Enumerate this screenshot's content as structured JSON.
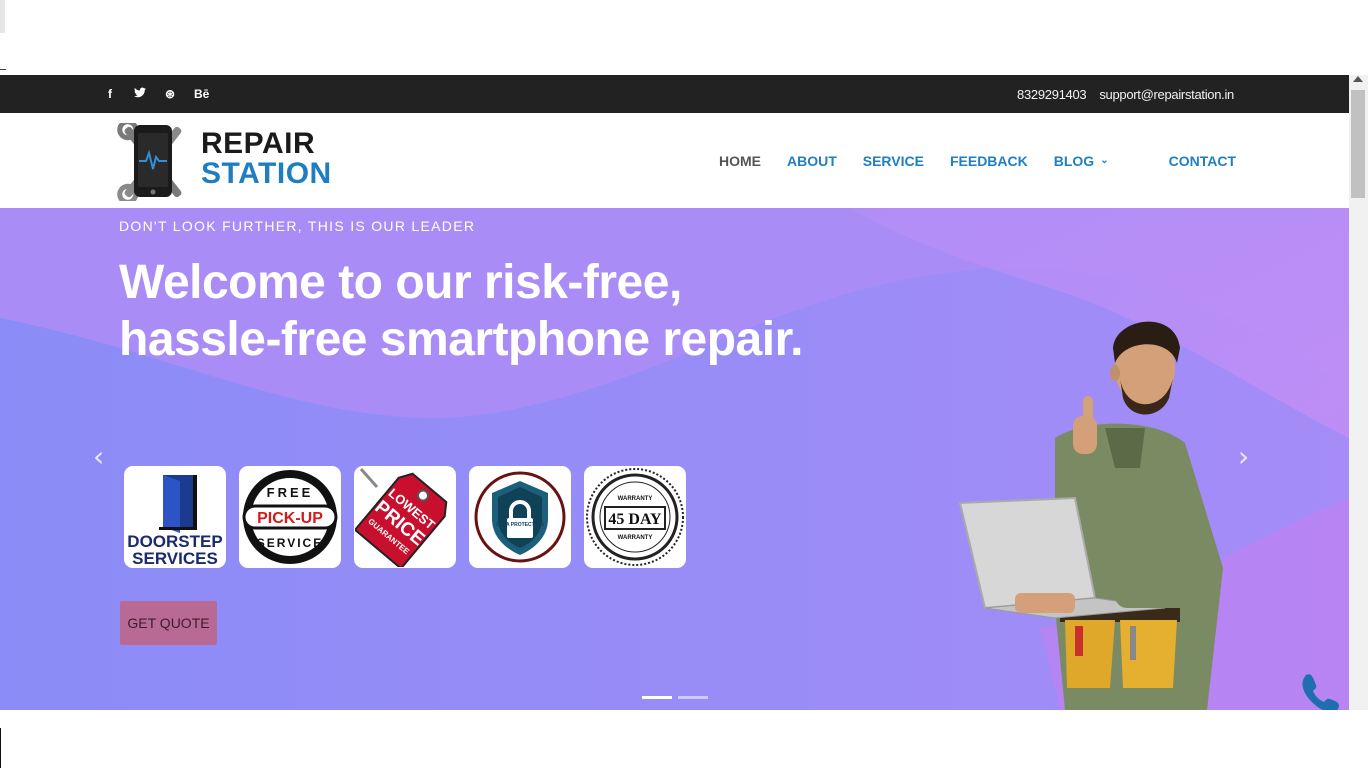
{
  "topbar": {
    "social": [
      {
        "icon": "facebook-icon",
        "glyph": "f"
      },
      {
        "icon": "twitter-icon",
        "glyph": "t"
      },
      {
        "icon": "dribbble-icon",
        "glyph": "⊛"
      },
      {
        "icon": "behance-icon",
        "glyph": "Bē"
      }
    ],
    "phone": "8329291403",
    "email": "support@repairstation.in"
  },
  "logo": {
    "line1": "REPAIR",
    "line2": "STATION"
  },
  "nav": {
    "home": "HOME",
    "about": "ABOUT",
    "service": "SERVICE",
    "feedback": "FEEDBACK",
    "blog": "BLOG",
    "contact": "CONTACT"
  },
  "hero": {
    "subtitle": "DON'T LOOK FURTHER, THIS IS OUR LEADER",
    "headline": "Welcome to our risk-free, hassle-free smartphone repair.",
    "cta": "GET QUOTE",
    "badges": {
      "doorstep": {
        "line1": "DOORSTEP",
        "line2": "SERVICES"
      },
      "pickup": {
        "top": "FREE",
        "middle": "PICK-UP",
        "bottom": "SERVICE"
      },
      "price": {
        "line1": "LOWEST",
        "line2": "PRICE",
        "line3": "GUARANTEE"
      },
      "data": {
        "text": "DATA PROTECTION"
      },
      "warranty": {
        "top": "WARRANTY",
        "middle": "45 DAY",
        "bottom": "WARRANTY"
      }
    },
    "slides_total": 2,
    "slide_active": 1
  },
  "colors": {
    "topbar": "#222222",
    "nav_link": "#1f7fc0",
    "nav_active": "#555555",
    "cta_bg": "#b86a94",
    "hero_purple": "#a58bf5",
    "logo_blue": "#1f7ec2"
  }
}
